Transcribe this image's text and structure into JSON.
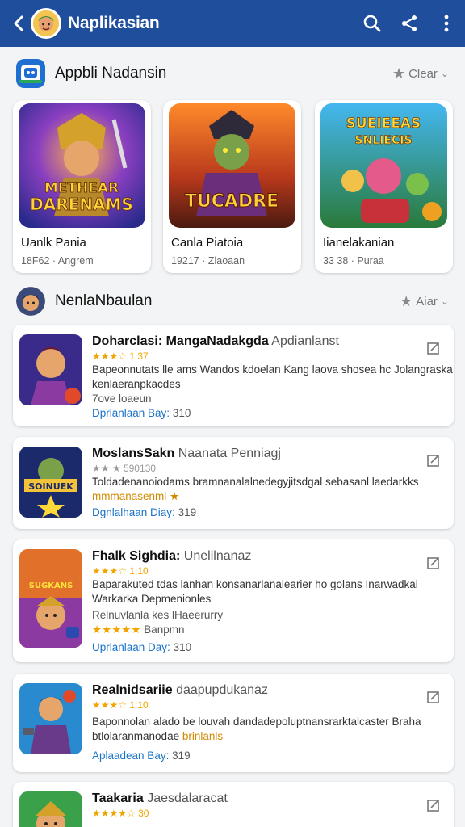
{
  "appbar": {
    "title": "Naplikasian",
    "icons": [
      "back-arrow-icon",
      "search-icon",
      "share-icon",
      "more-vertical-icon"
    ]
  },
  "section1": {
    "title": "Appbli Nadansin",
    "action": "Clear",
    "cards": [
      {
        "name": "Uanlk Pania",
        "meta": "18F62 · Angrem",
        "art_text_top": "METHEAR",
        "art_text": "DARENAMS"
      },
      {
        "name": "Canla Piatoia",
        "meta": "19217 · Zlaoaan",
        "art_text": "TUCADRE"
      },
      {
        "name": "Iianelakanian",
        "meta": "33 38 · Puraa",
        "art_text_top": "SUEIEEAS",
        "art_text": "SNLIECIS"
      }
    ]
  },
  "section2": {
    "title": "NenlaNbaulan",
    "action": "Aiar",
    "items": [
      {
        "title_bold": "Doharclasi: MangaNadakgda",
        "title_rest": "Apdianlanst",
        "stars": "★★★☆ 1:37",
        "desc1": "Bapeonnutats lle ams Wandos kdoelan Kang laova shosea hc Jolangraska",
        "desc2": "kenlaeranpkacdes",
        "desc3": "7ove loaeun",
        "date_label": "Dprlanlaan Bay:",
        "date_value": "310"
      },
      {
        "title_bold": "MoslansSakn",
        "title_rest": "Naanata Penniagj",
        "stars": "★★ ★ 590130",
        "desc1": "Toldadenanoiodams bramnanalalnedegyjitsdgal sebasanl laedarkks",
        "desc2": "mmmanasenmi ★",
        "date_label": "Dgnlalhaan Diay:",
        "date_value": "319"
      },
      {
        "title_bold": "Fhalk Sighdia:",
        "title_rest": "Unelilnanaz",
        "stars": "★★★☆ 1:10",
        "desc1": "Baparakuted tdas lanhan konsanarlanalearier ho golans Inarwadkai",
        "desc2": "Warkarka Depmenionles",
        "desc3": "Relnuvlanla kes lHaeerurry",
        "stars2": "★★★★★",
        "stars2_text": "Banpmn",
        "date_label": "Uprlanlaan Day:",
        "date_value": "310"
      },
      {
        "title_bold": "Realnidsariie",
        "title_rest": "daapupdukanaz",
        "stars": "★★★☆ 1:10",
        "desc1": "Baponnolan alado be louvah dandadepoluptnansrarktalcaster Braha",
        "desc2": "btlolaranmanodae",
        "desc2_hl": "brinlanls",
        "date_label": "Aplaadean Bay:",
        "date_value": "319"
      },
      {
        "title_bold": "Taakaria",
        "title_rest": "Jaesdalaracat",
        "stars": "★★★★☆ 30",
        "date_label": "",
        "date_value": ""
      }
    ]
  },
  "colors": {
    "appbar": "#1f4e9c",
    "link": "#1a73c9",
    "star": "#f0a500",
    "card": "#ffffff"
  }
}
